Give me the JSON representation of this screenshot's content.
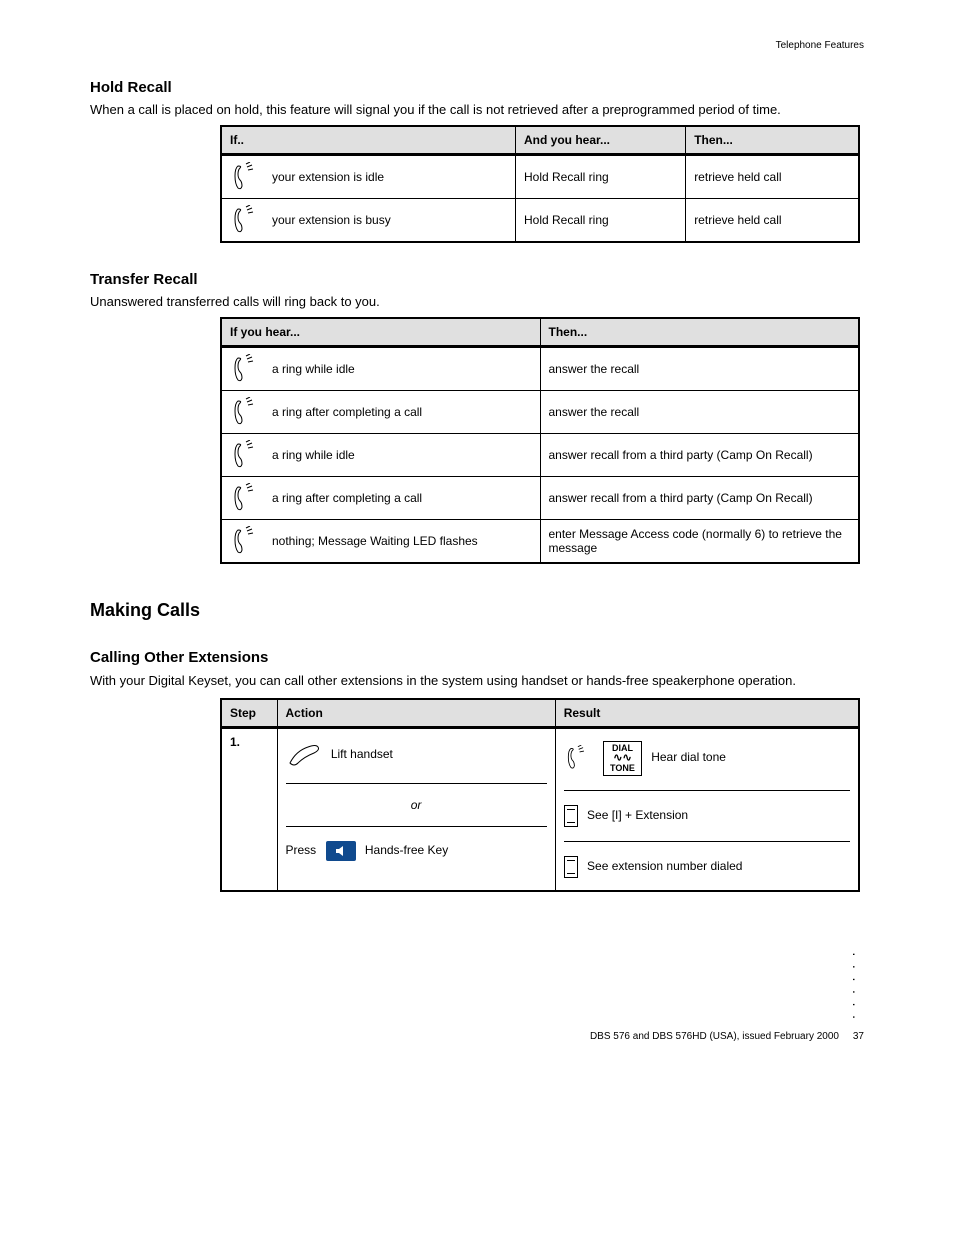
{
  "page_header_right": "Telephone Features",
  "section1": {
    "title": "Hold Recall",
    "desc": "When a call is placed on hold, this feature will signal you if the call is not retrieved after a preprogrammed period of time.",
    "headers": [
      "If..",
      "And you hear...",
      "Then..."
    ],
    "rows": [
      {
        "if": "your extension is idle",
        "and": "Hold Recall ring",
        "then": "retrieve held call"
      },
      {
        "if": "your extension is busy",
        "and": "Hold Recall ring",
        "then": "retrieve held call"
      }
    ]
  },
  "section2": {
    "title": "Transfer Recall",
    "desc": "Unanswered transferred calls will ring back to you.",
    "headers": [
      "If you hear...",
      "Then..."
    ],
    "rows": [
      {
        "if": "a ring while idle",
        "then": "answer the recall"
      },
      {
        "if": "a ring after completing a call",
        "then": "answer the recall"
      },
      {
        "if": "a ring while idle",
        "then": "answer recall from a third party (Camp On Recall)"
      },
      {
        "if": "a ring after completing a call",
        "then": "answer recall from a third party (Camp On Recall)"
      },
      {
        "if": "nothing; Message Waiting LED flashes",
        "then": "enter Message Access code (normally 6) to retrieve the message"
      }
    ]
  },
  "section3": {
    "title_1": "Making Calls",
    "title_2": "Calling Other Extensions",
    "desc": "With your Digital Keyset, you can call other extensions in the system using handset or hands-free speakerphone operation.",
    "headers": [
      "Step",
      "Action",
      "Result"
    ],
    "step_label": "1.",
    "action_lift": "Lift handset",
    "action_or": "or",
    "action_press": "Press  Hands-free Key",
    "result_hear": "Hear dial tone",
    "result_dial_label": "DIAL",
    "result_tone_label": "TONE",
    "result_line2": "See [I] + Extension",
    "result_line3": "See extension number dialed"
  },
  "footer": {
    "line1": "DBS 576 and DBS 576HD (USA), issued February 2000",
    "line2": "37"
  }
}
